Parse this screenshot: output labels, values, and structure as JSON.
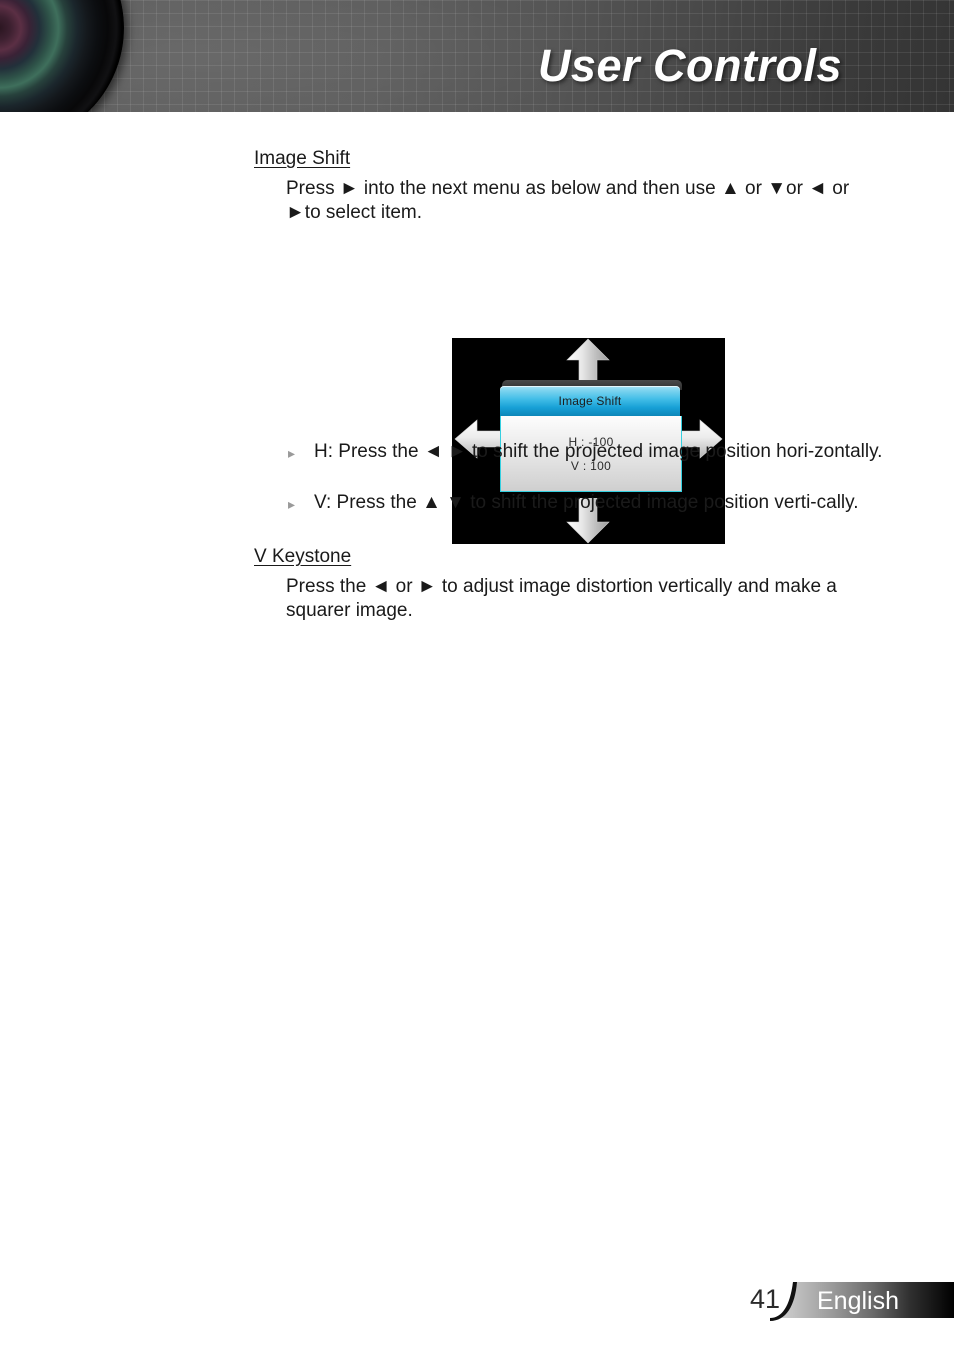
{
  "header": {
    "title": "User Controls",
    "lens_icon": "camera-lens-graphic"
  },
  "content": {
    "sections": [
      {
        "heading": "Image Shift",
        "paragraph": "Press ► into the next menu as below and then use ▲ or ▼or ◄ or ►to select item.",
        "bullets": [
          {
            "marker": "▸",
            "text": "H: Press the ◄ ► to shift the projected image position hori-zontally."
          },
          {
            "marker": "▸",
            "text": "V: Press the ▲ ▼ to shift the projected image position verti-cally."
          }
        ]
      },
      {
        "heading": "V Keystone",
        "paragraph": "Press the ◄ or ► to adjust image distortion vertically and make a squarer image.",
        "bullets": []
      }
    ]
  },
  "osd": {
    "title": "Image Shift",
    "rows": [
      {
        "label": "H :",
        "value": "-100",
        "display": "H : -100"
      },
      {
        "label": "V :",
        "value": "100",
        "display": "V :  100"
      }
    ],
    "arrows": [
      "arrow-up",
      "arrow-down",
      "arrow-left",
      "arrow-right"
    ],
    "colors": {
      "background": "#000000",
      "title_top": "#a9e3f5",
      "title_bottom": "#0d86b8",
      "border": "#35cfe0",
      "body_top": "#fdfdfd",
      "body_bottom": "#cfcfcf"
    }
  },
  "footer": {
    "page_number": "41",
    "language": "English",
    "colors": {
      "swoosh_light": "#c8c8c8",
      "swoosh_dark": "#000000",
      "page_number": "#2b2b2b"
    }
  }
}
